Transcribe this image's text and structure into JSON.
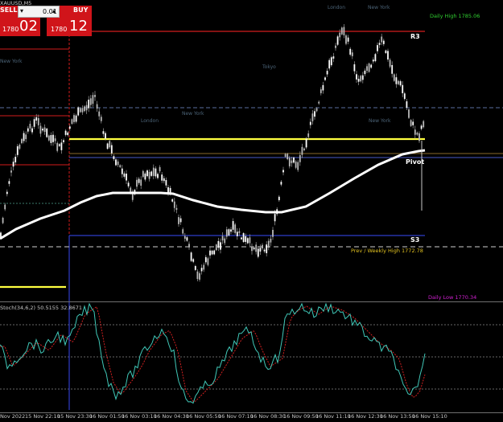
{
  "symbol_label": "XAUUSD,M5",
  "trade_panel": {
    "sell_label": "SELL",
    "buy_label": "BUY",
    "lot_value": "0.01",
    "lot_minus": "▾",
    "lot_plus": "▴",
    "sell_price_small": "1780",
    "sell_price_big": "02",
    "buy_price_small": "1780",
    "buy_price_big": "12"
  },
  "levels": {
    "daily_high": "Daily High 1785.06",
    "r3": "R3",
    "pivot": "Pivot",
    "s3": "S3",
    "prev_weekly_high": "Prev / Weekly High 1772.78",
    "daily_low": "Daily Low 1770.34"
  },
  "sessions": {
    "new_york_left": "New York",
    "tokyo": "Tokyo",
    "london_mid": "London",
    "new_york_mid": "New York",
    "london_top": "London",
    "new_york_top": "New York",
    "new_york_right": "New York"
  },
  "indicator_label": "Stoch(34,6,2) 50.5155 32.8671",
  "x_axis_labels": [
    "Nov 2022",
    "15 Nov 22:10",
    "15 Nov 23:30",
    "16 Nov 01:50",
    "16 Nov 03:10",
    "16 Nov 04:30",
    "16 Nov 05:50",
    "16 Nov 07:10",
    "16 Nov 08:30",
    "16 Nov 09:50",
    "16 Nov 11:10",
    "16 Nov 12:30",
    "16 Nov 13:50",
    "16 Nov 15:10"
  ],
  "colors": {
    "background": "#000000",
    "candle_up": "#b8b8b8",
    "candle_down": "#ffffff",
    "moving_average": "#ffffff",
    "yellow_line": "#ffff40",
    "red_line": "#d21c1c",
    "blue_line": "#2e3cc8",
    "stoch_main": "#40c8b8",
    "stoch_signal": "#d02020",
    "daily_high_text": "#30d030",
    "daily_low_text": "#d020d0",
    "prev_weekly_text": "#e0c020",
    "session_text": "#4c6478",
    "trade_button": "#d0141a"
  }
}
